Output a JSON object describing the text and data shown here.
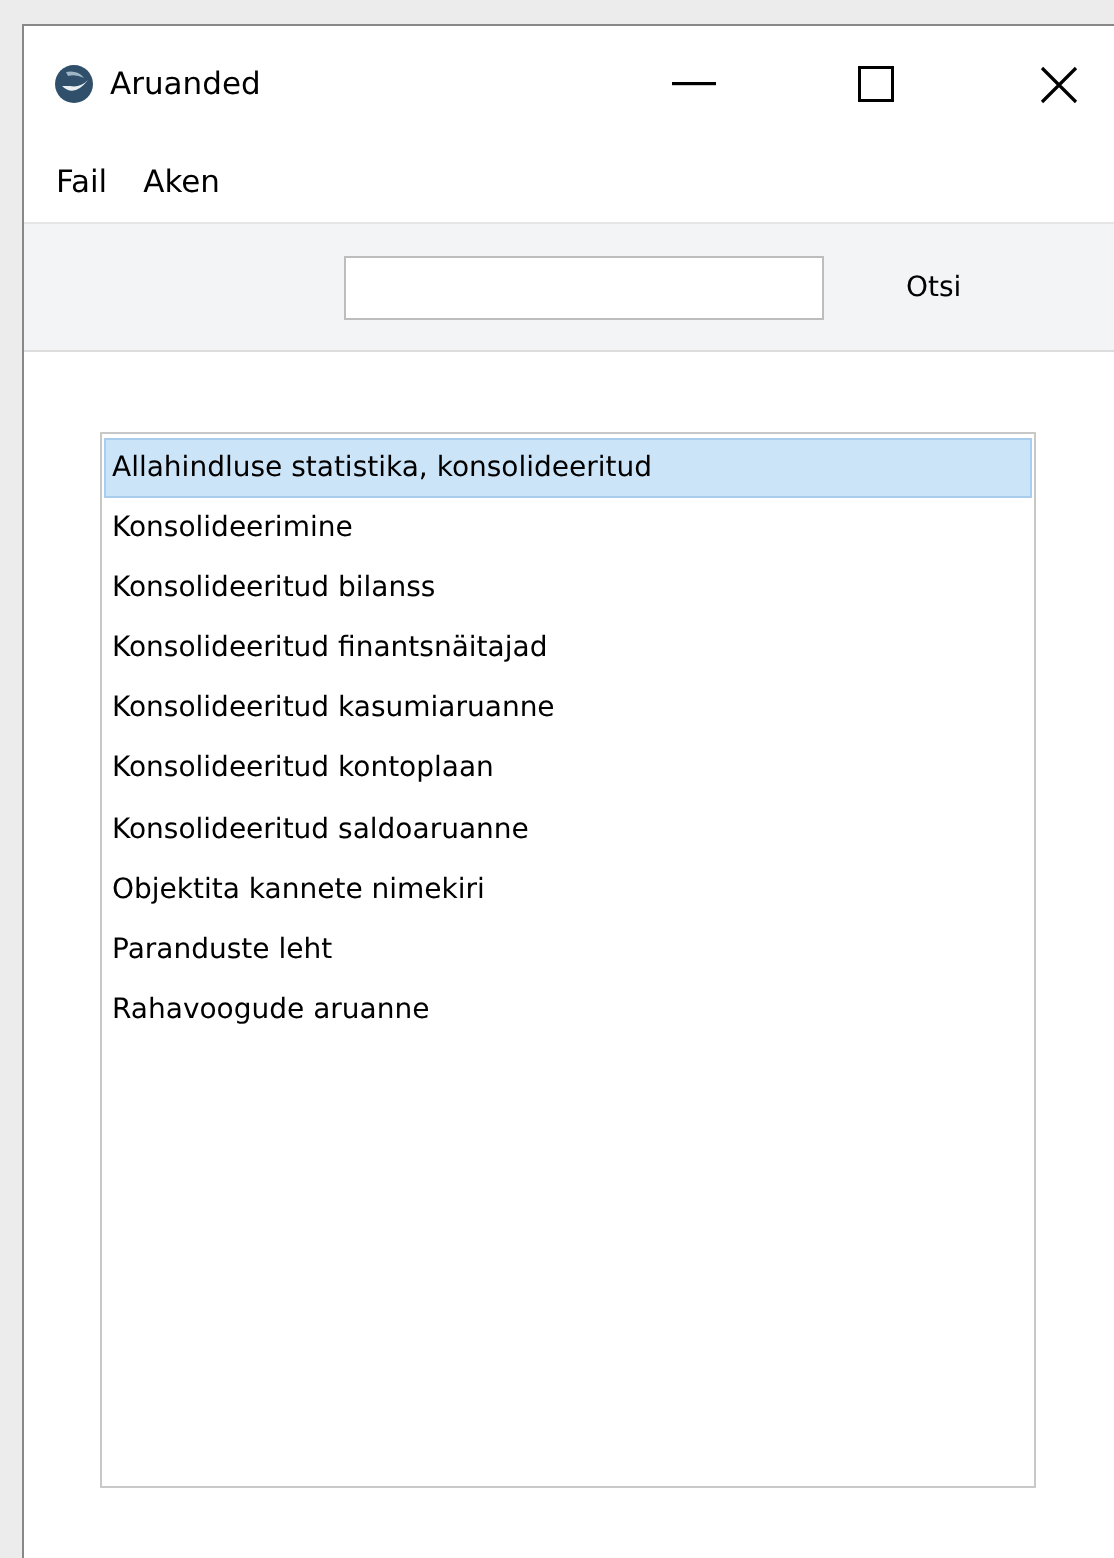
{
  "window": {
    "title": "Aruanded"
  },
  "menu": [
    {
      "label": "Fail"
    },
    {
      "label": "Aken"
    }
  ],
  "toolbar": {
    "search_button": "Otsi"
  },
  "list": [
    {
      "label": "Allahindluse statistika, konsolideeritud",
      "selected": true
    },
    {
      "label": "Konsolideerimine",
      "selected": false
    },
    {
      "label": "Konsolideeritud bilanss",
      "selected": false
    },
    {
      "label": "Konsolideeritud finantsnäitajad",
      "selected": false
    },
    {
      "label": "Konsolideeritud kasumiaruanne",
      "selected": false
    },
    {
      "label": "Konsolideeritud kontoplaan",
      "selected": false
    },
    {
      "label": "Konsolideeritud saldoaruanne",
      "selected": false
    },
    {
      "label": "Objektita kannete nimekiri",
      "selected": false
    },
    {
      "label": "Paranduste leht",
      "selected": false
    },
    {
      "label": "Rahavoogude aruanne",
      "selected": false
    }
  ]
}
